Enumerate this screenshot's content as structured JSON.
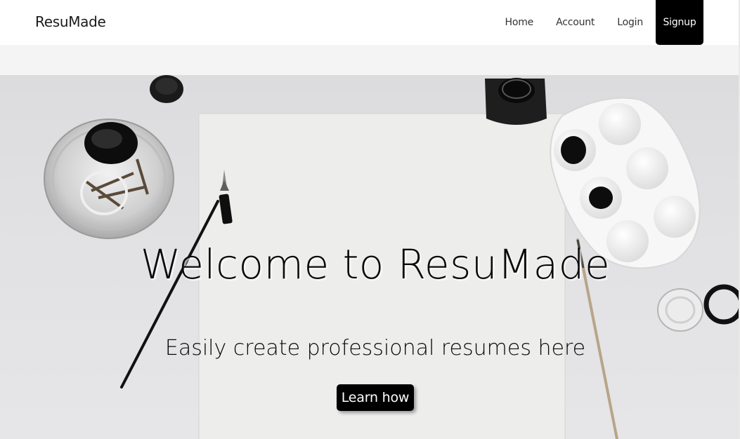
{
  "navbar": {
    "brand": "ResuMade",
    "links": [
      "Home",
      "Account",
      "Login"
    ],
    "signup": "Signup"
  },
  "hero": {
    "title": "Welcome to ResuMade",
    "subtitle": "Easily create professional resumes here",
    "cta": "Learn how",
    "background_image": "desk-flatlay-ink-paper-palette"
  },
  "colors": {
    "accent": "#000000",
    "navbar_bg": "#ffffff",
    "subbar_bg": "#f4f4f4",
    "hero_bg": "#e0e0e2"
  }
}
